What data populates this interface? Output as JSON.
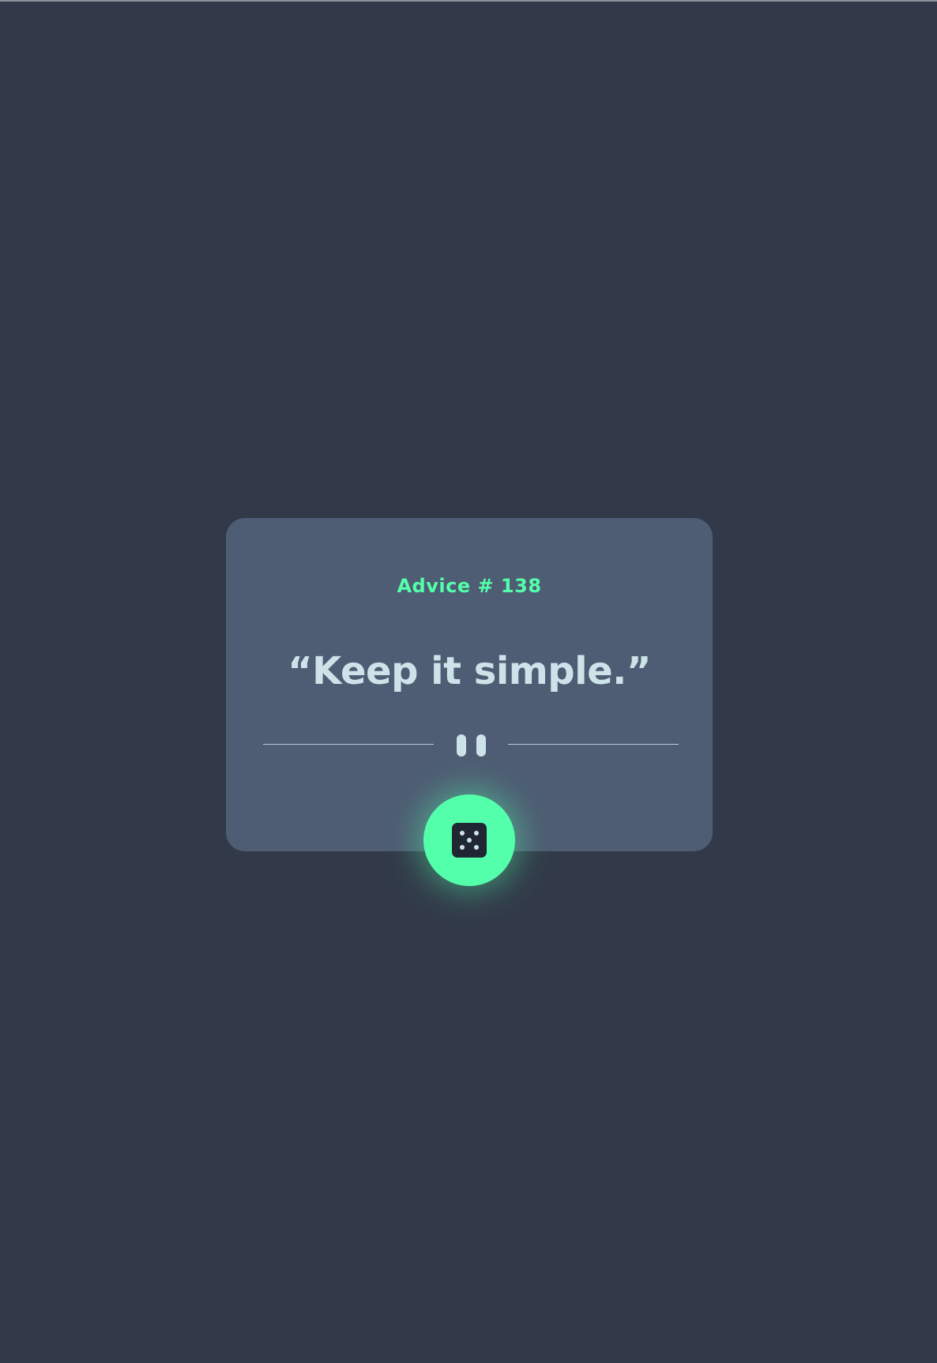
{
  "card": {
    "advice_label": "Advice # 138",
    "quote": "“Keep it simple.”"
  },
  "icons": {
    "divider": "pause-icon",
    "button": "dice-icon"
  },
  "colors": {
    "background": "#323a49",
    "card": "#4e5d73",
    "accent": "#53ffaa",
    "text": "#cee3e9",
    "dice_face": "#202733"
  }
}
